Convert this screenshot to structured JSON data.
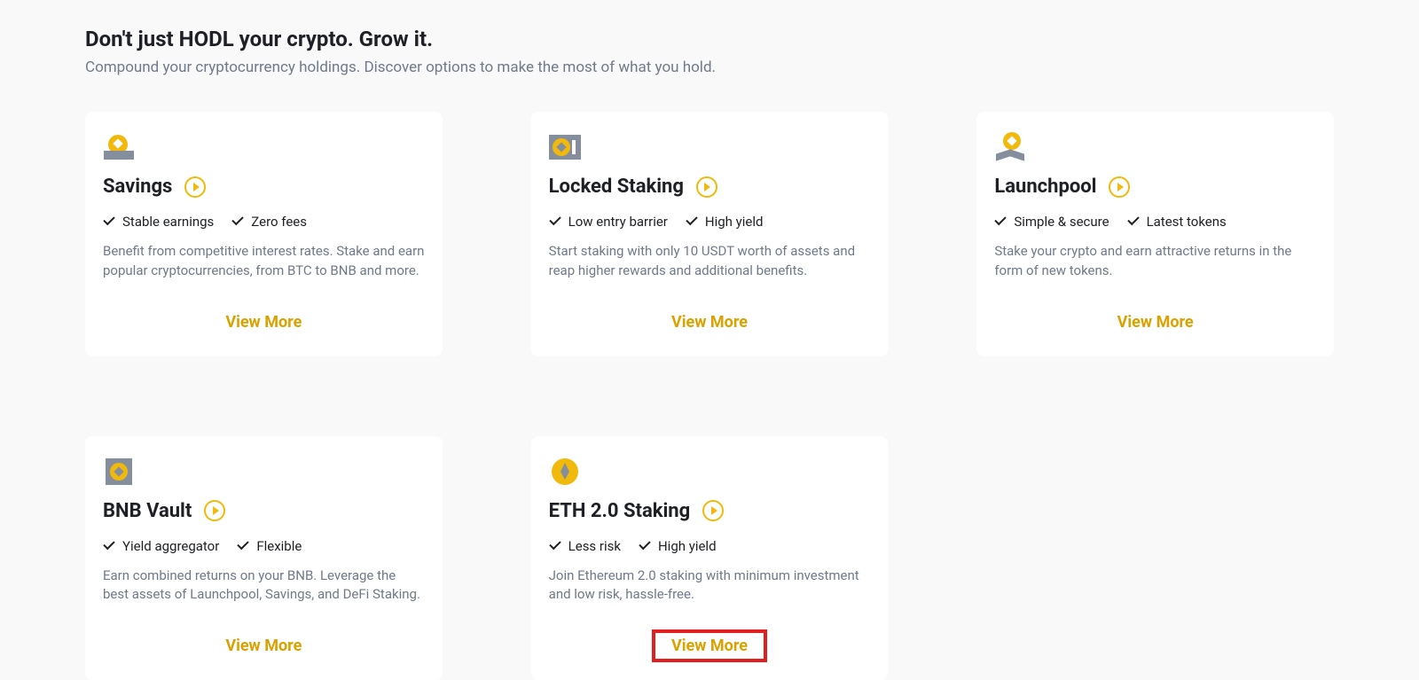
{
  "header": {
    "title": "Don't just HODL your crypto. Grow it.",
    "subtitle": "Compound your cryptocurrency holdings. Discover options to make the most of what you hold."
  },
  "cards": [
    {
      "icon": "savings",
      "title": "Savings",
      "features": [
        "Stable earnings",
        "Zero fees"
      ],
      "description": "Benefit from competitive interest rates. Stake and earn popular cryptocurrencies, from BTC to BNB and more.",
      "cta": "View More",
      "highlighted": false
    },
    {
      "icon": "locked-staking",
      "title": "Locked Staking",
      "features": [
        "Low entry barrier",
        "High yield"
      ],
      "description": "Start staking with only 10 USDT worth of assets and reap higher rewards and additional benefits.",
      "cta": "View More",
      "highlighted": false
    },
    {
      "icon": "launchpool",
      "title": "Launchpool",
      "features": [
        "Simple & secure",
        "Latest tokens"
      ],
      "description": "Stake your crypto and earn attractive returns in the form of new tokens.",
      "cta": "View More",
      "highlighted": false
    },
    {
      "icon": "bnb-vault",
      "title": "BNB Vault",
      "features": [
        "Yield aggregator",
        "Flexible"
      ],
      "description": "Earn combined returns on your BNB. Leverage the best assets of Launchpool, Savings, and DeFi Staking.",
      "cta": "View More",
      "highlighted": false
    },
    {
      "icon": "eth-staking",
      "title": "ETH 2.0 Staking",
      "features": [
        "Less risk",
        "High yield"
      ],
      "description": "Join Ethereum 2.0 staking with minimum investment and low risk, hassle-free.",
      "cta": "View More",
      "highlighted": true
    }
  ]
}
